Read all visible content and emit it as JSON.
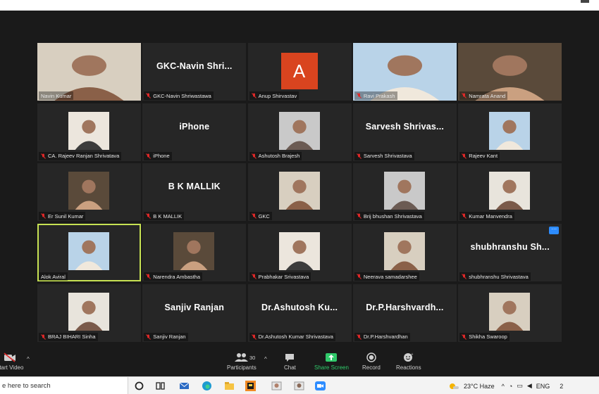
{
  "participants": [
    {
      "name": "Navin Kumar",
      "display": "video",
      "muted": false
    },
    {
      "name": "GKC-Navin Shriwastawa",
      "display": "text",
      "big": "GKC-Navin  Shri...",
      "muted": true
    },
    {
      "name": "Anup Shirvastav",
      "display": "avatar",
      "initial": "A",
      "muted": true
    },
    {
      "name": "Ravi Prakash",
      "display": "video",
      "muted": true
    },
    {
      "name": "Namrata Anand",
      "display": "video",
      "muted": true
    },
    {
      "name": "CA. Rajeev Ranjan Shrivatava",
      "display": "photo",
      "muted": true
    },
    {
      "name": "iPhone",
      "display": "text",
      "big": "iPhone",
      "muted": true
    },
    {
      "name": "Ashutosh Brajesh",
      "display": "photo",
      "muted": true
    },
    {
      "name": "Sarvesh Shrivastava",
      "display": "text",
      "big": "Sarvesh  Shrivas...",
      "muted": true
    },
    {
      "name": "Rajeev Kant",
      "display": "photo",
      "muted": true
    },
    {
      "name": "Er Sunil Kumar",
      "display": "photo",
      "muted": true
    },
    {
      "name": "B K MALLIK",
      "display": "text",
      "big": "B K MALLIK",
      "muted": true
    },
    {
      "name": "GKC",
      "display": "photo",
      "muted": true
    },
    {
      "name": "Brij bhushan Shrivastava",
      "display": "photo",
      "muted": true
    },
    {
      "name": "Kumar Manvendra",
      "display": "photo",
      "muted": true
    },
    {
      "name": "Alok Aviral",
      "display": "photo",
      "muted": false,
      "active": true
    },
    {
      "name": "Narendra Ambastha",
      "display": "photo",
      "muted": true
    },
    {
      "name": "Prabhakar Srivastava",
      "display": "photo",
      "muted": true
    },
    {
      "name": "Neerava samadarshee",
      "display": "photo",
      "muted": true
    },
    {
      "name": "shubhranshu Shrivastava",
      "display": "text",
      "big": "shubhranshu  Sh...",
      "muted": true,
      "menu": true
    },
    {
      "name": "BRAJ BIHARI Sinha",
      "display": "photo",
      "muted": true
    },
    {
      "name": "Sanjiv Ranjan",
      "display": "text",
      "big": "Sanjiv Ranjan",
      "muted": true
    },
    {
      "name": "Dr.Ashutosh Kumar Shrivastava",
      "display": "text",
      "big": "Dr.Ashutosh  Ku...",
      "muted": true
    },
    {
      "name": "Dr.P.Harshvardhan",
      "display": "text",
      "big": "Dr.P.Harshvardh...",
      "muted": true
    },
    {
      "name": "Shikha Swaroop",
      "display": "photo",
      "muted": true
    }
  ],
  "toolbar": {
    "start_video": "Start Video",
    "participants": "Participants",
    "participants_count": "30",
    "chat": "Chat",
    "share": "Share Screen",
    "record": "Record",
    "reactions": "Reactions"
  },
  "taskbar": {
    "search_placeholder": "e here to search",
    "weather": "23°C  Haze",
    "lang": "ENG",
    "clock_fragment": "2"
  },
  "colors": {
    "accent": "#2d8cff",
    "active_border": "#c7e253",
    "share": "#30c96a",
    "mute": "#e02828"
  }
}
